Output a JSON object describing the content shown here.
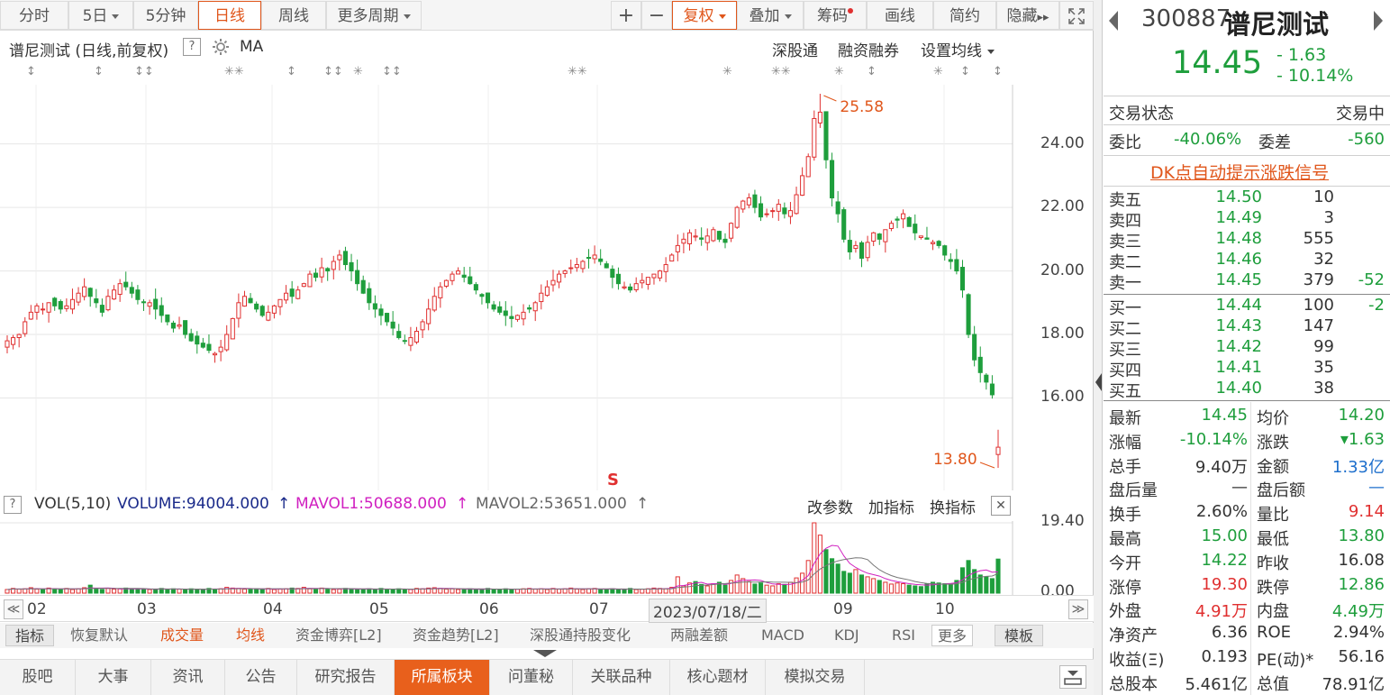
{
  "toolbar": {
    "periods": [
      "分时",
      "5日",
      "5分钟",
      "日线",
      "周线",
      "更多周期"
    ],
    "active_period": "日线",
    "plus": "+",
    "minus": "−",
    "fuquan": "复权",
    "diejia": "叠加",
    "chouma": "筹码",
    "huaxian": "画线",
    "jianyue": "简约",
    "yincang": "隐藏",
    "hide_arrows": "▸▸"
  },
  "chart_header": {
    "title": "谱尼测试 (日线,前复权)",
    "help": "?",
    "ma": "MA",
    "links": [
      "深股通",
      "融资融券",
      "设置均线"
    ]
  },
  "price_axis": [
    "24.00",
    "22.00",
    "20.00",
    "18.00",
    "16.00"
  ],
  "annotations": {
    "high": "25.58",
    "low": "13.80",
    "s_marker": "S"
  },
  "volume_header": {
    "help": "?",
    "name": "VOL(5,10)",
    "volume": "VOLUME:94004.000",
    "mavol1": "MAVOL1:50688.000",
    "mavol2": "MAVOL2:53651.000",
    "links": [
      "改参数",
      "加指标",
      "换指标"
    ],
    "close": "✕"
  },
  "volume_axis": [
    "19.40",
    "0.00"
  ],
  "date_bar": {
    "months": [
      "02",
      "03",
      "04",
      "05",
      "06",
      "07",
      "09",
      "10"
    ],
    "current": "2023/07/18/二",
    "left": "≪",
    "right": "≫"
  },
  "indicators": [
    "指标",
    "恢复默认",
    "成交量",
    "均线",
    "资金博弈[L2]",
    "资金趋势[L2]",
    "深股通持股变化",
    "两融差额",
    "MACD",
    "KDJ",
    "RSI",
    "更多",
    "模板"
  ],
  "bottom_tabs": [
    "股吧",
    "大事",
    "资讯",
    "公告",
    "研究报告",
    "所属板块",
    "问董秘",
    "关联品种",
    "核心题材",
    "模拟交易"
  ],
  "active_tab": "所属板块",
  "quote": {
    "code": "300887",
    "name": "谱尼测试",
    "price": "14.45",
    "change": "- 1.63",
    "change_pct": "- 10.14%",
    "status_label": "交易状态",
    "status": "交易中",
    "weibi_label": "委比",
    "weibi": "-40.06%",
    "weicha_label": "委差",
    "weicha": "-560",
    "dk_link": "DK点自动提示涨跌信号"
  },
  "orderbook": {
    "asks": [
      {
        "label": "卖五",
        "price": "14.50",
        "vol": "10",
        "chg": ""
      },
      {
        "label": "卖四",
        "price": "14.49",
        "vol": "3",
        "chg": ""
      },
      {
        "label": "卖三",
        "price": "14.48",
        "vol": "555",
        "chg": ""
      },
      {
        "label": "卖二",
        "price": "14.46",
        "vol": "32",
        "chg": ""
      },
      {
        "label": "卖一",
        "price": "14.45",
        "vol": "379",
        "chg": "-52"
      }
    ],
    "bids": [
      {
        "label": "买一",
        "price": "14.44",
        "vol": "100",
        "chg": "-2"
      },
      {
        "label": "买二",
        "price": "14.43",
        "vol": "147",
        "chg": ""
      },
      {
        "label": "买三",
        "price": "14.42",
        "vol": "99",
        "chg": ""
      },
      {
        "label": "买四",
        "price": "14.41",
        "vol": "35",
        "chg": ""
      },
      {
        "label": "买五",
        "price": "14.40",
        "vol": "38",
        "chg": ""
      }
    ]
  },
  "stats": [
    {
      "l1": "最新",
      "v1": "14.45",
      "c1": "g",
      "l2": "均价",
      "v2": "14.20",
      "c2": "g"
    },
    {
      "l1": "涨幅",
      "v1": "-10.14%",
      "c1": "g",
      "l2": "涨跌",
      "v2": "▾1.63",
      "c2": "g"
    },
    {
      "l1": "总手",
      "v1": "9.40万",
      "c1": "dk",
      "l2": "金额",
      "v2": "1.33亿",
      "c2": "b"
    },
    {
      "l1": "盘后量",
      "v1": "—",
      "c1": "dk",
      "l2": "盘后额",
      "v2": "—",
      "c2": "b"
    },
    {
      "l1": "换手",
      "v1": "2.60%",
      "c1": "dk",
      "l2": "量比",
      "v2": "9.14",
      "c2": "r"
    },
    {
      "l1": "最高",
      "v1": "15.00",
      "c1": "g",
      "l2": "最低",
      "v2": "13.80",
      "c2": "g"
    },
    {
      "l1": "今开",
      "v1": "14.22",
      "c1": "g",
      "l2": "昨收",
      "v2": "16.08",
      "c2": "dk"
    },
    {
      "l1": "涨停",
      "v1": "19.30",
      "c1": "r",
      "l2": "跌停",
      "v2": "12.86",
      "c2": "g"
    },
    {
      "l1": "外盘",
      "v1": "4.91万",
      "c1": "r",
      "l2": "内盘",
      "v2": "4.49万",
      "c2": "g"
    },
    {
      "l1": "净资产",
      "v1": "6.36",
      "c1": "dk",
      "l2": "ROE",
      "v2": "2.94%",
      "c2": "dk"
    },
    {
      "l1": "收益(Ξ)",
      "v1": "0.193",
      "c1": "dk",
      "l2": "PE(动)*",
      "v2": "56.16",
      "c2": "dk"
    },
    {
      "l1": "总股本",
      "v1": "5.461亿",
      "c1": "dk",
      "l2": "总值",
      "v2": "78.91亿",
      "c2": "dk"
    }
  ],
  "chart_data": {
    "type": "candlestick",
    "price_range": [
      13.8,
      25.58
    ],
    "closes": [
      17.8,
      17.9,
      18.0,
      18.4,
      18.7,
      18.9,
      18.8,
      19.0,
      18.9,
      18.8,
      18.9,
      19.1,
      19.3,
      19.5,
      19.2,
      19.0,
      18.7,
      19.2,
      19.4,
      19.6,
      19.5,
      19.3,
      19.1,
      19.0,
      19.0,
      18.8,
      18.6,
      18.4,
      18.2,
      18.3,
      18.0,
      17.8,
      17.7,
      17.6,
      17.5,
      17.4,
      17.6,
      18.0,
      18.5,
      19.0,
      19.2,
      19.0,
      18.8,
      18.6,
      18.7,
      18.9,
      19.1,
      19.3,
      19.2,
      19.4,
      19.6,
      19.9,
      19.8,
      20.1,
      20.0,
      20.3,
      20.5,
      20.2,
      20.0,
      19.6,
      19.3,
      19.0,
      18.8,
      18.6,
      18.4,
      18.2,
      17.9,
      17.8,
      17.9,
      18.1,
      18.4,
      18.8,
      19.2,
      19.5,
      19.7,
      19.9,
      20.0,
      19.8,
      19.6,
      19.4,
      19.2,
      19.0,
      18.8,
      18.7,
      18.6,
      18.5,
      18.6,
      18.7,
      18.8,
      19.0,
      19.3,
      19.5,
      19.7,
      19.9,
      20.0,
      20.1,
      20.2,
      20.3,
      20.4,
      20.5,
      20.3,
      20.1,
      19.8,
      19.6,
      19.5,
      19.4,
      19.6,
      19.7,
      19.8,
      19.9,
      20.0,
      20.2,
      20.5,
      20.8,
      21.0,
      21.2,
      21.1,
      21.0,
      21.1,
      21.3,
      21.0,
      20.9,
      21.5,
      22.0,
      22.2,
      22.3,
      22.0,
      21.7,
      21.8,
      21.9,
      22.1,
      21.8,
      21.9,
      22.4,
      23.0,
      23.6,
      24.8,
      25.0,
      23.5,
      22.3,
      21.8,
      21.0,
      20.6,
      20.8,
      20.4,
      20.9,
      21.2,
      21.0,
      21.3,
      21.5,
      21.6,
      21.8,
      21.4,
      21.2,
      21.1,
      21.0,
      20.9,
      20.8,
      20.5,
      20.3,
      20.0,
      19.4,
      18.0,
      17.2,
      16.8,
      16.5,
      16.1,
      14.45
    ],
    "volume_range": [
      0,
      19.4
    ],
    "volume": [
      1.0,
      1.3,
      1.1,
      1.2,
      1.5,
      1.1,
      1.0,
      1.4,
      1.2,
      1.1,
      1.3,
      1.0,
      1.2,
      1.5,
      2.2,
      1.1,
      1.0,
      1.3,
      1.1,
      1.2,
      1.4,
      1.0,
      1.1,
      1.2,
      1.0,
      1.1,
      1.3,
      1.0,
      1.2,
      1.1,
      1.0,
      1.2,
      1.1,
      1.0,
      1.3,
      1.1,
      1.2,
      1.6,
      1.4,
      1.3,
      1.1,
      1.0,
      1.2,
      1.1,
      1.3,
      1.0,
      1.1,
      1.2,
      1.4,
      1.3,
      1.6,
      1.2,
      1.1,
      1.4,
      1.2,
      1.0,
      1.1,
      1.3,
      1.2,
      1.0,
      1.1,
      1.2,
      1.0,
      1.3,
      1.1,
      1.0,
      1.2,
      1.1,
      1.0,
      1.3,
      1.2,
      1.4,
      1.5,
      1.3,
      1.1,
      1.2,
      1.0,
      1.1,
      1.2,
      1.0,
      1.1,
      1.3,
      1.0,
      1.1,
      1.2,
      1.0,
      1.1,
      1.2,
      1.3,
      1.1,
      1.2,
      1.0,
      1.3,
      1.1,
      1.2,
      1.4,
      1.1,
      1.0,
      1.2,
      1.3,
      1.0,
      1.1,
      1.2,
      1.0,
      1.1,
      1.3,
      1.0,
      1.1,
      1.2,
      1.4,
      1.3,
      1.2,
      1.6,
      4.5,
      2.0,
      2.8,
      3.2,
      2.4,
      2.0,
      2.6,
      3.0,
      2.2,
      3.5,
      5.0,
      4.0,
      3.2,
      2.5,
      2.8,
      2.2,
      2.0,
      2.6,
      2.4,
      3.0,
      4.2,
      5.5,
      9.0,
      19.4,
      16.0,
      12.0,
      9.5,
      8.0,
      6.0,
      5.5,
      6.5,
      5.0,
      4.5,
      4.0,
      3.5,
      3.0,
      2.5,
      2.8,
      2.6,
      2.2,
      2.0,
      1.8,
      2.5,
      3.0,
      2.8,
      2.6,
      2.4,
      3.5,
      7.0,
      9.0,
      6.5,
      5.0,
      4.5,
      4.0,
      9.4
    ]
  }
}
